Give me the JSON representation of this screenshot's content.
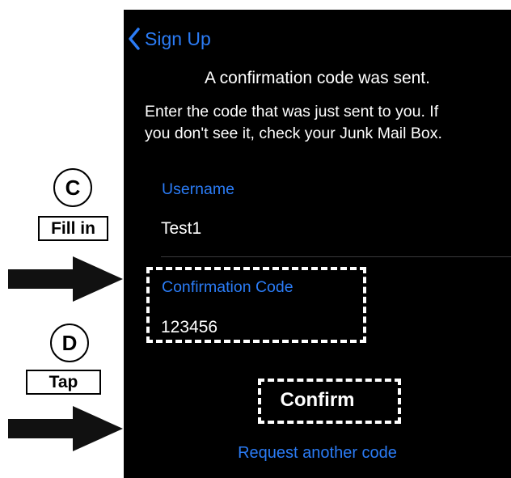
{
  "nav": {
    "back_label": "Sign Up"
  },
  "header": {
    "title": "A confirmation code was sent.",
    "instructions_line1": "Enter the code that was just sent to you.  If",
    "instructions_line2": "you don't see it, check your Junk Mail Box."
  },
  "form": {
    "username_label": "Username",
    "username_value": "Test1",
    "code_label": "Confirmation Code",
    "code_value": "123456",
    "confirm_label": "Confirm",
    "request_label": "Request another code"
  },
  "annotations": {
    "step_c": {
      "letter": "C",
      "action": "Fill in"
    },
    "step_d": {
      "letter": "D",
      "action": "Tap"
    }
  },
  "colors": {
    "accent": "#2b7cf6",
    "screen_bg": "#000000",
    "text": "#ffffff",
    "annotation": "#000000"
  },
  "icons": {
    "back": "chevron-left-icon",
    "pointer": "arrow-right-icon"
  }
}
